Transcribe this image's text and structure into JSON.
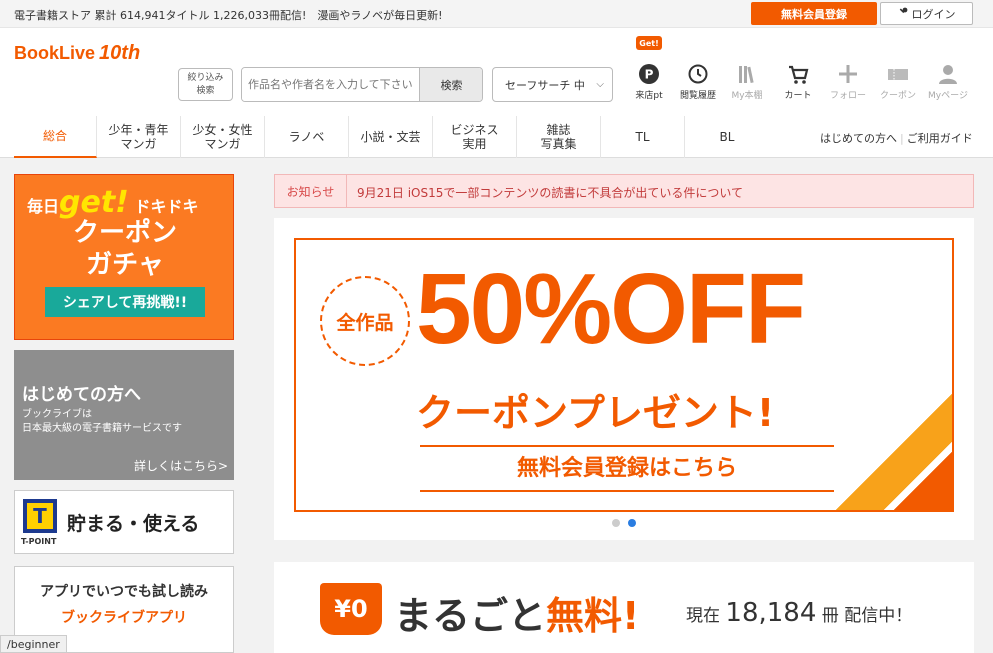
{
  "topbar": {
    "store_note": "電子書籍ストア 累計 614,941タイトル 1,226,033冊配信!　漫画やラノベが毎日更新!",
    "register_label": "無料会員登録",
    "login_label": "ログイン"
  },
  "header": {
    "logo_text": "BookLive",
    "logo_badge": "10th",
    "filter_line1": "絞り込み",
    "filter_line2": "検索",
    "search": {
      "placeholder": "作品名や作者名を入力して下さい",
      "button": "検索"
    },
    "safe_search": "セーフサーチ 中",
    "get_badge": "Get!",
    "icons": [
      {
        "label": "来店pt",
        "icon": "point-icon"
      },
      {
        "label": "閲覧履歴",
        "icon": "history-icon"
      },
      {
        "label": "My本棚",
        "icon": "bookshelf-icon"
      },
      {
        "label": "カート",
        "icon": "cart-icon"
      },
      {
        "label": "フォロー",
        "icon": "plus-icon"
      },
      {
        "label": "クーポン",
        "icon": "coupon-icon"
      },
      {
        "label": "Myページ",
        "icon": "user-icon"
      }
    ]
  },
  "nav": {
    "items": [
      {
        "label": "総合"
      },
      {
        "label": "少年・青年\nマンガ"
      },
      {
        "label": "少女・女性\nマンガ"
      },
      {
        "label": "ラノベ"
      },
      {
        "label": "小説・文芸"
      },
      {
        "label": "ビジネス\n実用"
      },
      {
        "label": "雑誌\n写真集"
      },
      {
        "label": "TL"
      },
      {
        "label": "BL"
      }
    ],
    "beginner_link": "はじめての方へ",
    "guide_link": "ご利用ガイド"
  },
  "side": {
    "gacha": {
      "mainichi": "毎日",
      "get": "get!",
      "dokidoki": "ドキドキ",
      "title": "クーポン\nガチャ",
      "share": "シェアして再挑戦!!"
    },
    "beginner": {
      "title": "はじめての方へ",
      "desc": "ブックライブは\n日本最大級の電子書籍サービスです",
      "more": "詳しくはこちら>"
    },
    "tpoint": {
      "mark": "T",
      "label": "T-POINT",
      "text": "貯まる・使える"
    },
    "app": {
      "line1": "アプリでいつでも試し読み",
      "line2": "ブックライブアプリ"
    }
  },
  "notice": {
    "label": "お知らせ",
    "message": "9月21日 iOS15で一部コンテンツの読書に不具合が出ている件について"
  },
  "banner": {
    "circle": "全作品",
    "off": "50%OFF",
    "coupon": "クーポンプレゼント!",
    "register": "無料会員登録はこちら",
    "dots": 2,
    "active_dot": 2
  },
  "free": {
    "badge": "¥0",
    "title_a": "まるごと",
    "title_b": "無料!",
    "count_pre": "現在",
    "count_num": "18,184",
    "count_unit": "冊",
    "count_post": "配信中！"
  },
  "status_url": "/beginner",
  "colors": {
    "brand": "#f25a00",
    "teal": "#19a99a",
    "notice_bg": "#fde4e4",
    "dot_active": "#2a7de1"
  }
}
